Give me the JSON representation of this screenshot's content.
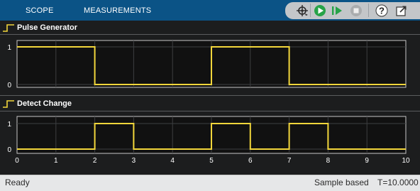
{
  "toolstrip": {
    "tabs": [
      "SCOPE",
      "MEASUREMENTS"
    ]
  },
  "quick_access": {
    "buttons": [
      "signal-select-icon",
      "run-icon",
      "step-forward-icon",
      "stop-icon",
      "help-icon",
      "undock-icon"
    ]
  },
  "plots": [
    {
      "title": "Pulse Generator",
      "chart_data": {
        "type": "line",
        "step": true,
        "x": [
          0,
          2,
          2,
          5,
          5,
          7,
          7,
          10
        ],
        "y": [
          1,
          1,
          0,
          0,
          1,
          1,
          0,
          0
        ],
        "ylim": [
          0,
          1
        ],
        "xlim": [
          0,
          10
        ],
        "yticks": [
          "0",
          "1"
        ],
        "grid": true,
        "color": "#f2d63b"
      }
    },
    {
      "title": "Detect Change",
      "chart_data": {
        "type": "line",
        "step": true,
        "x": [
          0,
          2,
          2,
          3,
          3,
          5,
          5,
          6,
          6,
          7,
          7,
          8,
          8,
          10
        ],
        "y": [
          0,
          0,
          1,
          1,
          0,
          0,
          1,
          1,
          0,
          0,
          1,
          1,
          0,
          0
        ],
        "ylim": [
          0,
          1
        ],
        "xlim": [
          0,
          10
        ],
        "yticks": [
          "0",
          "1"
        ],
        "xticks": [
          "0",
          "1",
          "2",
          "3",
          "4",
          "5",
          "6",
          "7",
          "8",
          "9",
          "10"
        ],
        "grid": true,
        "color": "#f2d63b"
      }
    }
  ],
  "status": {
    "left": "Ready",
    "mode": "Sample based",
    "time": "T=10.0000"
  }
}
